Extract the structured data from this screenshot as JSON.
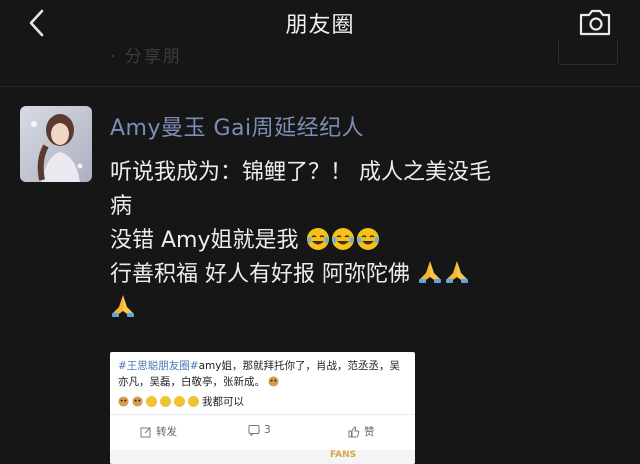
{
  "header": {
    "title": "朋友圈",
    "faded_line": "·  分享朋"
  },
  "post": {
    "author": "Amy曼玉 Gai周延经纪人",
    "line1": "听说我成为：锦鲤了？！ 成人之美没毛",
    "line2": "病",
    "line3_text": "没错 Amy姐就是我",
    "line4_text": "行善积福 好人有好报 阿弥陀佛",
    "colors": {
      "author": "#7c8db6",
      "background": "#161616"
    },
    "emoji": [
      "crying-laughing",
      "crying-laughing",
      "crying-laughing",
      "praying-hands",
      "praying-hands",
      "praying-hands"
    ]
  },
  "repost": {
    "tag": "#王思聪朋友圈#",
    "text": "amy姐，那就拜托你了，肖战，范丞丞，吴亦凡，吴磊，白敬亭，张新成。",
    "tail": "我都可以",
    "actions": {
      "forward": "转发",
      "comments": "3",
      "like": "赞"
    },
    "fans_label": "FANS"
  }
}
